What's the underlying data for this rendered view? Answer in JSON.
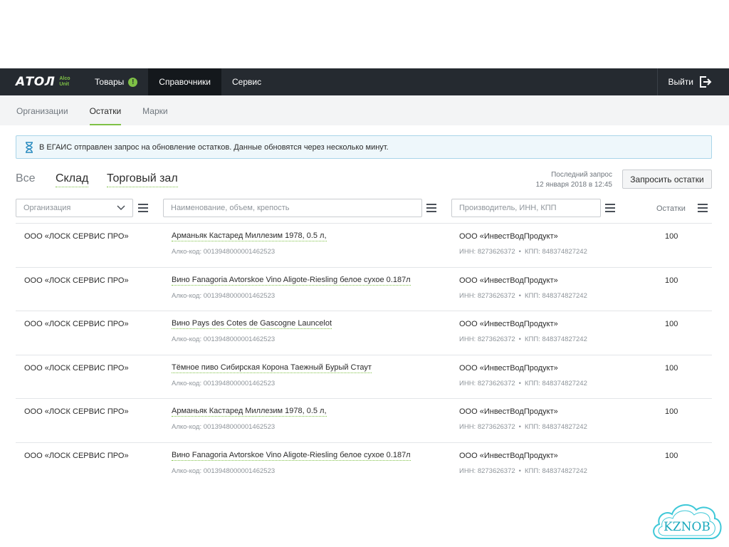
{
  "logo": {
    "main": "АТОЛ",
    "sub1": "Alco",
    "sub2": "Unit"
  },
  "nav": {
    "items": [
      {
        "label": "Товары",
        "badge": "!"
      },
      {
        "label": "Справочники"
      },
      {
        "label": "Сервис"
      }
    ],
    "logout": "Выйти"
  },
  "subnav": {
    "items": [
      "Организации",
      "Остатки",
      "Марки"
    ]
  },
  "notice": "В ЕГАИС отправлен запрос на обновление остатков. Данные обновятся через несколько минут.",
  "view_tabs": [
    "Все",
    "Склад",
    "Торговый зал"
  ],
  "last_request": {
    "label": "Последний запрос",
    "value": "12 января 2018 в 12:45"
  },
  "request_button": "Запросить остатки",
  "filters": {
    "organization": "Организация",
    "name_placeholder": "Наименование, объем, крепость",
    "producer_placeholder": "Производитель, ИНН, КПП",
    "qty_label": "Остатки"
  },
  "rows": [
    {
      "org": "ООО «ЛОСК СЕРВИС ПРО»",
      "name": "Арманьяк Кастаред Миллезим 1978, 0.5 л,",
      "code": "Алко-код: 0013948000001462523",
      "producer": "ООО «ИнвестВодПродукт»",
      "inn": "ИНН: 8273626372",
      "kpp": "КПП: 848374827242",
      "qty": "100"
    },
    {
      "org": "ООО «ЛОСК СЕРВИС ПРО»",
      "name": "Вино Fanagoria Avtorskoe Vino Aligote-Riesling белое сухое 0.187л",
      "code": "Алко-код: 0013948000001462523",
      "producer": "ООО «ИнвестВодПродукт»",
      "inn": "ИНН: 8273626372",
      "kpp": "КПП: 848374827242",
      "qty": "100"
    },
    {
      "org": "ООО «ЛОСК СЕРВИС ПРО»",
      "name": "Вино Pays des Cotes de Gascogne Launcelot",
      "code": "Алко-код: 0013948000001462523",
      "producer": "ООО «ИнвестВодПродукт»",
      "inn": "ИНН: 8273626372",
      "kpp": "КПП: 848374827242",
      "qty": "100"
    },
    {
      "org": "ООО «ЛОСК СЕРВИС ПРО»",
      "name": "Тёмное пиво Сибирская Корона Таежный Бурый Стаут",
      "code": "Алко-код: 0013948000001462523",
      "producer": "ООО «ИнвестВодПродукт»",
      "inn": "ИНН: 8273626372",
      "kpp": "КПП: 848374827242",
      "qty": "100"
    },
    {
      "org": "ООО «ЛОСК СЕРВИС ПРО»",
      "name": "Арманьяк Кастаред Миллезим 1978, 0.5 л,",
      "code": "Алко-код: 0013948000001462523",
      "producer": "ООО «ИнвестВодПродукт»",
      "inn": "ИНН: 8273626372",
      "kpp": "КПП: 848374827242",
      "qty": "100"
    },
    {
      "org": "ООО «ЛОСК СЕРВИС ПРО»",
      "name": "Вино Fanagoria Avtorskoe Vino Aligote-Riesling белое сухое 0.187л",
      "code": "Алко-код: 0013948000001462523",
      "producer": "ООО «ИнвестВодПродукт»",
      "inn": "ИНН: 8273626372",
      "kpp": "КПП: 848374827242",
      "qty": "100"
    }
  ],
  "watermark": "KZNOB",
  "colors": {
    "accent": "#7fc146",
    "navbar": "#252a30",
    "notice_bg": "#eef7fb",
    "notice_border": "#a9d5e9"
  }
}
